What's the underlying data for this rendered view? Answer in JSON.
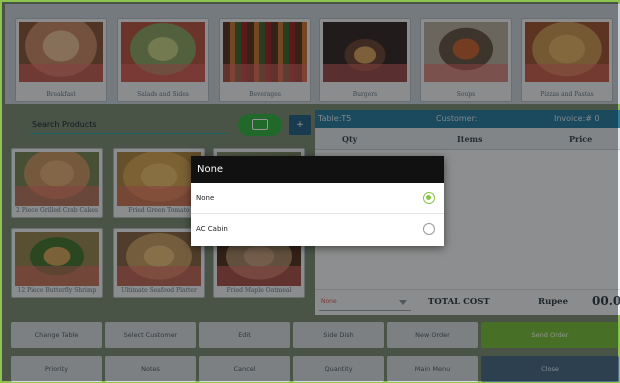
{
  "categories": [
    {
      "label": "Breakfast",
      "icon": "breakfast-plate-image",
      "color": "#c98a6b"
    },
    {
      "label": "Salads and Sides",
      "icon": "salad-bowl-image",
      "color": "#8fa56a"
    },
    {
      "label": "Beverages",
      "icon": "beverage-bottles-image",
      "color": "#9c6f5a"
    },
    {
      "label": "Burgers",
      "icon": "burger-image",
      "color": "#6d4a3a"
    },
    {
      "label": "Soups",
      "icon": "soup-bowl-image",
      "color": "#a06a4a"
    },
    {
      "label": "Pizzas and Pastas",
      "icon": "pizza-image",
      "color": "#c89a5a"
    }
  ],
  "search": {
    "placeholder": "Search Products"
  },
  "keyboard_button": {
    "icon": "keyboard-icon"
  },
  "add_button": {
    "label": "+"
  },
  "products": [
    {
      "label": "2 Piece Grilled Crab Cakes",
      "color": "#c99a6a"
    },
    {
      "label": "Fried Green Tomato",
      "color": "#d5a85a"
    },
    {
      "label": "",
      "color": "#8c9a7a"
    },
    {
      "label": "12 Piece Butterfly Shrimp",
      "color": "#9a8a5a"
    },
    {
      "label": "Ultimate Seafood Platter",
      "color": "#c8a06a"
    },
    {
      "label": "Fried Maple Oatmeal",
      "color": "#a68a6a"
    }
  ],
  "order": {
    "table": "Table:T5",
    "customer": "Customer:",
    "invoice": "Invoice:# 0",
    "columns": [
      "Qty",
      "Items",
      "Price"
    ],
    "selector_value": "None",
    "total_label": "TOTAL COST",
    "currency": "Rupee",
    "total_value": "00.00"
  },
  "actions_row1": [
    "Change Table",
    "Select Customer",
    "Edit",
    "Side Dish",
    "New Order",
    "Send Order"
  ],
  "actions_row2": [
    "Priority",
    "Notes",
    "Cancel",
    "Quantity",
    "Main Menu",
    "Close"
  ],
  "dialog": {
    "title": "None",
    "options": [
      {
        "label": "None",
        "selected": true
      },
      {
        "label": "AC Cabin",
        "selected": false
      }
    ]
  },
  "colors": {
    "accent_green": "#39b54a",
    "primary_blue": "#2f7ea0",
    "radio_on": "#8bc34a"
  }
}
